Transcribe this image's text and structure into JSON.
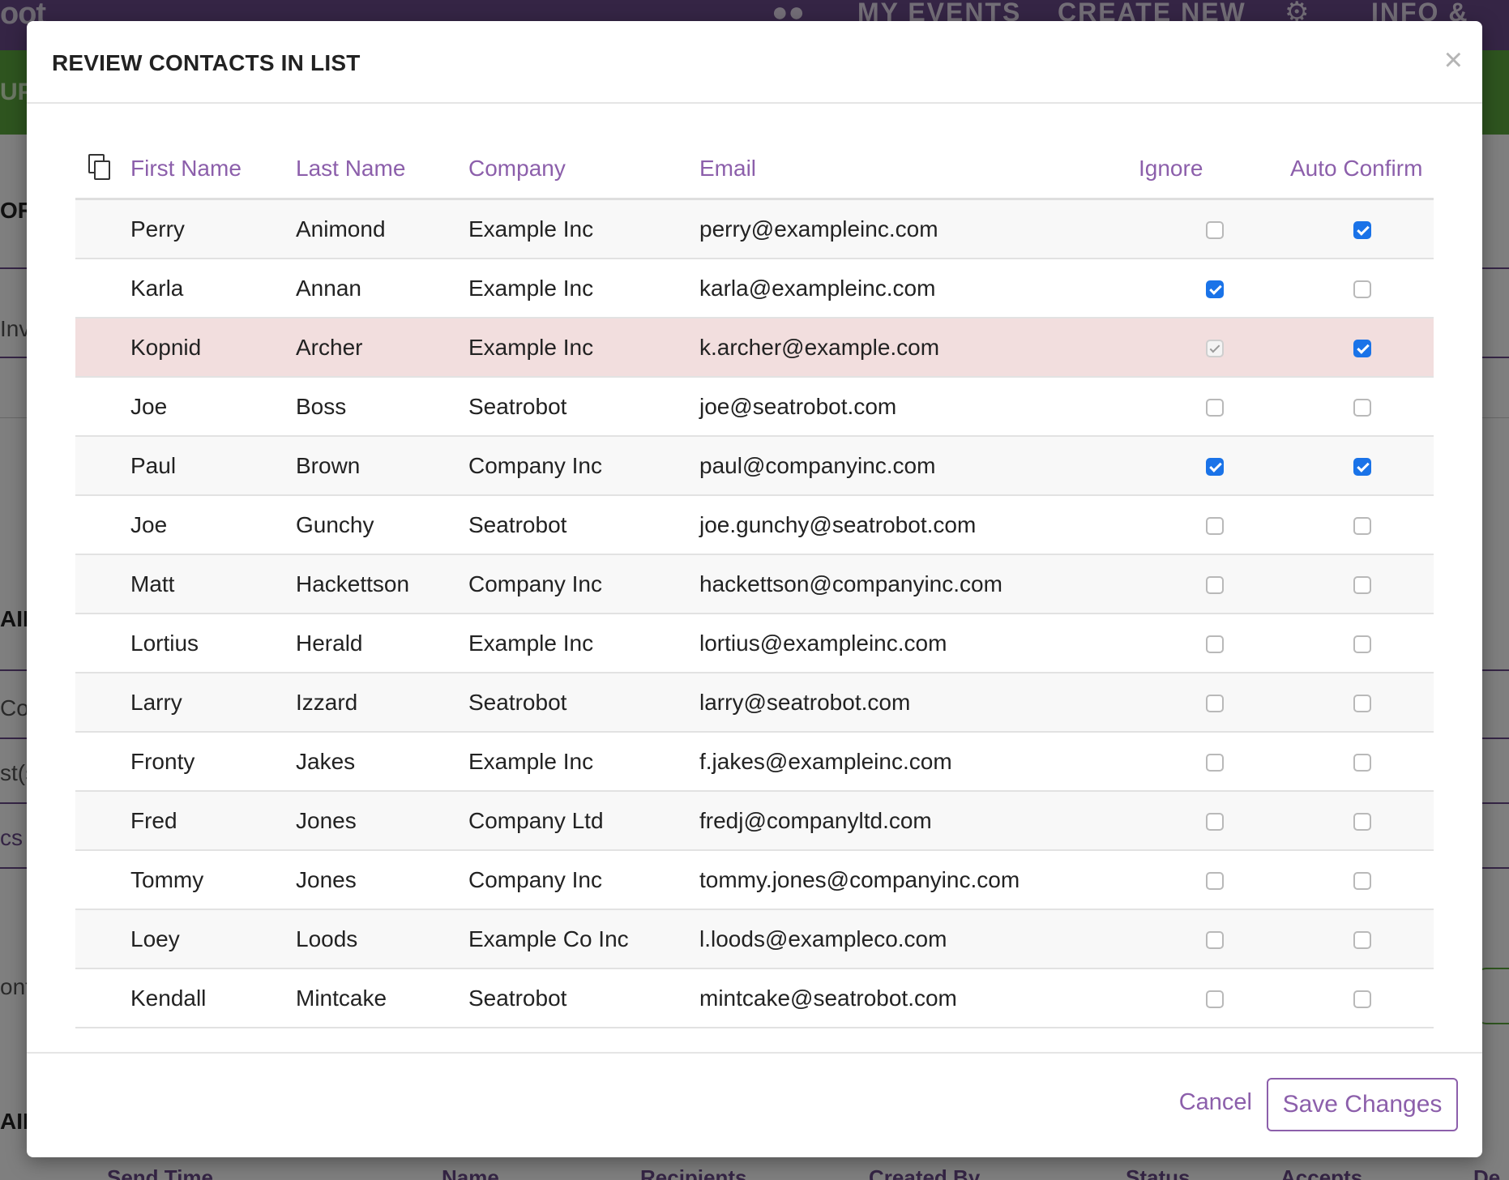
{
  "background": {
    "logo_text": "oot",
    "nav": [
      "MY EVENTS",
      "CREATE NEW",
      "INFO & SU"
    ],
    "banner_text": "UP",
    "side_fragments": [
      "OR",
      "Inv",
      "AIL",
      "Co",
      "st(s",
      "cs",
      "ont",
      "AIL"
    ],
    "bottom_headers": [
      "Send Time",
      "Name",
      "Recipients",
      "Created By",
      "Status",
      "Accepts",
      "De"
    ]
  },
  "modal": {
    "title": "REVIEW CONTACTS IN LIST",
    "close_glyph": "×",
    "columns": {
      "first_name": "First Name",
      "last_name": "Last Name",
      "company": "Company",
      "email": "Email",
      "ignore": "Ignore",
      "auto_confirm": "Auto Confirm"
    },
    "rows": [
      {
        "first": "Perry",
        "last": "Animond",
        "company": "Example Inc",
        "email": "perry@exampleinc.com",
        "ignore": false,
        "auto_confirm": true
      },
      {
        "first": "Karla",
        "last": "Annan",
        "company": "Example Inc",
        "email": "karla@exampleinc.com",
        "ignore": true,
        "auto_confirm": false
      },
      {
        "first": "Kopnid",
        "last": "Archer",
        "company": "Example Inc",
        "email": "k.archer@example.com",
        "ignore": "disabled",
        "auto_confirm": true,
        "flagged": true
      },
      {
        "first": "Joe",
        "last": "Boss",
        "company": "Seatrobot",
        "email": "joe@seatrobot.com",
        "ignore": false,
        "auto_confirm": false
      },
      {
        "first": "Paul",
        "last": "Brown",
        "company": "Company Inc",
        "email": "paul@companyinc.com",
        "ignore": true,
        "auto_confirm": true
      },
      {
        "first": "Joe",
        "last": "Gunchy",
        "company": "Seatrobot",
        "email": "joe.gunchy@seatrobot.com",
        "ignore": false,
        "auto_confirm": false
      },
      {
        "first": "Matt",
        "last": "Hackettson",
        "company": "Company Inc",
        "email": "hackettson@companyinc.com",
        "ignore": false,
        "auto_confirm": false
      },
      {
        "first": "Lortius",
        "last": "Herald",
        "company": "Example Inc",
        "email": "lortius@exampleinc.com",
        "ignore": false,
        "auto_confirm": false
      },
      {
        "first": "Larry",
        "last": "Izzard",
        "company": "Seatrobot",
        "email": "larry@seatrobot.com",
        "ignore": false,
        "auto_confirm": false
      },
      {
        "first": "Fronty",
        "last": "Jakes",
        "company": "Example Inc",
        "email": "f.jakes@exampleinc.com",
        "ignore": false,
        "auto_confirm": false
      },
      {
        "first": "Fred",
        "last": "Jones",
        "company": "Company Ltd",
        "email": "fredj@companyltd.com",
        "ignore": false,
        "auto_confirm": false
      },
      {
        "first": "Tommy",
        "last": "Jones",
        "company": "Company Inc",
        "email": "tommy.jones@companyinc.com",
        "ignore": false,
        "auto_confirm": false
      },
      {
        "first": "Loey",
        "last": "Loods",
        "company": "Example Co Inc",
        "email": "l.loods@exampleco.com",
        "ignore": false,
        "auto_confirm": false
      },
      {
        "first": "Kendall",
        "last": "Mintcake",
        "company": "Seatrobot",
        "email": "mintcake@seatrobot.com",
        "ignore": false,
        "auto_confirm": false
      }
    ],
    "footer": {
      "cancel_label": "Cancel",
      "save_label": "Save Changes"
    }
  },
  "colors": {
    "accent": "#8c5fab",
    "checkbox_on": "#1a73e8",
    "flagged_row": "#f2dede",
    "nav_bg": "#6b4a8a",
    "banner_bg": "#5da83f"
  }
}
